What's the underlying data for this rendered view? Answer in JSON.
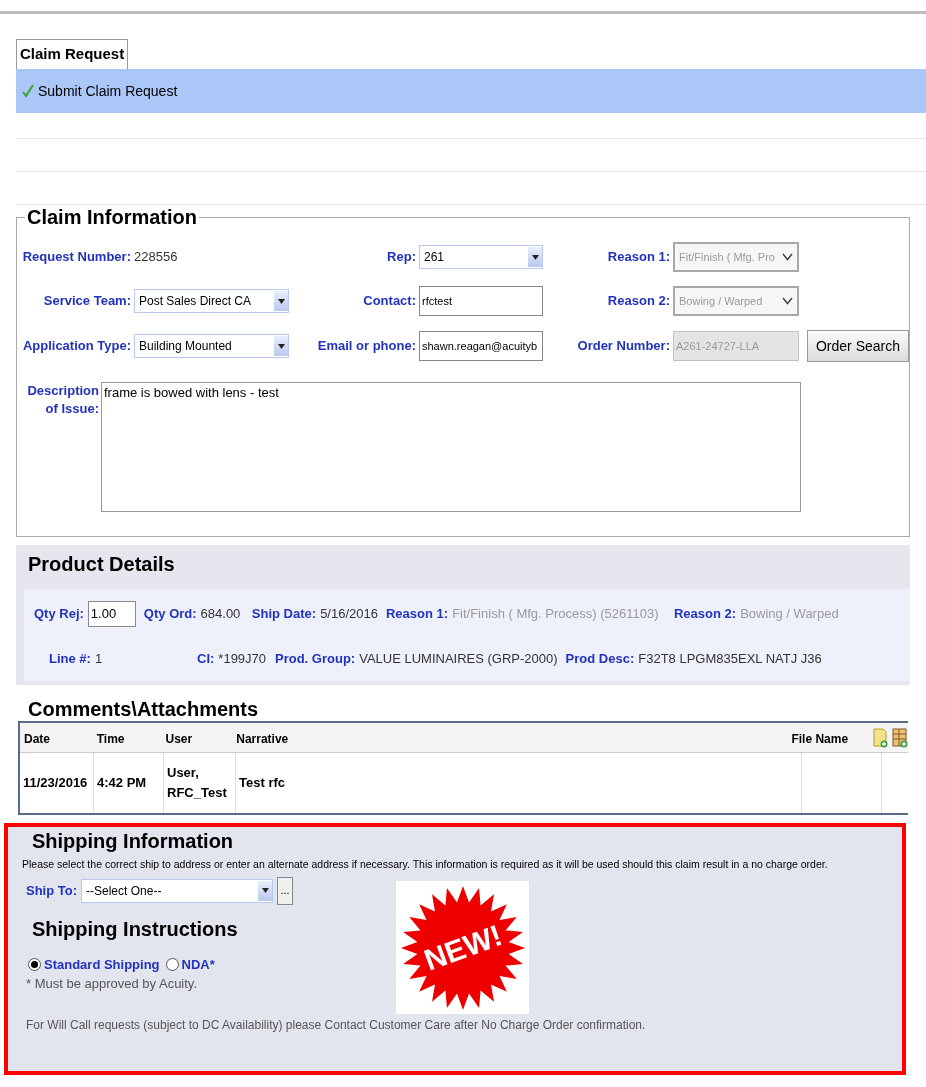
{
  "tabs": [
    {
      "label": "Claim Request",
      "selected": true
    }
  ],
  "action_bar": {
    "label": "Submit Claim Request"
  },
  "claim_information": {
    "title": "Claim Information",
    "rows": [
      [
        {
          "kind": "text",
          "label": "Request Number:",
          "value": "228556"
        },
        {
          "kind": "select",
          "label": "Rep:",
          "value": "261"
        },
        {
          "kind": "dropdown",
          "label": "Reason 1:",
          "value": "Fit/Finish ( Mfg. Pro",
          "disabled": true
        }
      ],
      [
        {
          "kind": "select",
          "label": "Service Team:",
          "value": "Post Sales Direct CA"
        },
        {
          "kind": "input",
          "label": "Contact:",
          "value": "rfctest"
        },
        {
          "kind": "dropdown",
          "label": "Reason 2:",
          "value": "Bowing / Warped",
          "disabled": true
        }
      ],
      [
        {
          "kind": "select",
          "label": "Application Type:",
          "value": "Building Mounted"
        },
        {
          "kind": "input",
          "label": "Email or phone:",
          "value": "shawn.reagan@acuityb"
        },
        {
          "kind": "input",
          "label": "Order Number:",
          "value": "A261-24727-LLA",
          "disabled": true
        }
      ]
    ],
    "order_search_button": "Order Search",
    "description": {
      "label": "Description of Issue:",
      "value": "frame is bowed with lens - test"
    }
  },
  "product_details": {
    "title": "Product Details",
    "rows": [
      [
        {
          "kind": "input",
          "label": "Qty Rej:",
          "value": "1.00"
        },
        {
          "kind": "text",
          "label": "Qty Ord:",
          "value": "684.00",
          "disabled": false
        },
        {
          "kind": "text",
          "label": "Ship Date:",
          "value": "5/16/2016",
          "disabled": false
        },
        {
          "kind": "text",
          "label": "Reason 1:",
          "value": "Fit/Finish ( Mfg. Process) (5261103)",
          "disabled": true
        },
        {
          "kind": "text",
          "label": "Reason 2:",
          "value": "Bowing / Warped",
          "disabled": true
        }
      ],
      [
        {
          "kind": "text",
          "label": "Line #:",
          "value": "1",
          "disabled": false
        },
        {
          "kind": "text",
          "label": "CI:",
          "value": "*199J70",
          "disabled": false
        },
        {
          "kind": "text",
          "label": "Prod. Group:",
          "value": "VALUE LUMINAIRES (GRP-2000)",
          "disabled": false
        },
        {
          "kind": "text",
          "label": "Prod Desc:",
          "value": "F32T8 LPGM835EXL NATJ J36",
          "disabled": false
        }
      ]
    ]
  },
  "comments": {
    "title": "Comments\\Attachments",
    "columns": [
      "Date",
      "Time",
      "User",
      "Narrative",
      "File Name"
    ],
    "rows": [
      {
        "date": "11/23/2016",
        "time": "4:42 PM",
        "user": "User, RFC_Test",
        "narrative": "Test rfc"
      }
    ]
  },
  "shipping": {
    "title": "Shipping Information",
    "notice": "Please select the correct ship to address or enter an alternate address if necessary. This information is required as it will be used should this claim result in a no charge order.",
    "ship_to": {
      "label": "Ship To:",
      "value": "--Select One--",
      "browse_button": "..."
    },
    "instructions_title": "Shipping Instructions",
    "options": [
      {
        "label": "Standard Shipping",
        "selected": true
      },
      {
        "label": "NDA*",
        "selected": false
      }
    ],
    "approval_note": "* Must be approved by Acuity.",
    "will_call_note": "For Will Call requests (subject to DC Availability) please Contact Customer Care after No Charge Order confirmation.",
    "badge": "NEW!"
  }
}
